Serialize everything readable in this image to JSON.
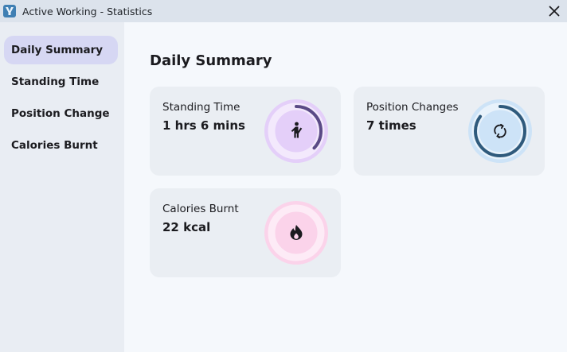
{
  "window": {
    "title": "Active Working - Statistics",
    "app_icon": "app-logo-icon",
    "close_icon": "close-icon"
  },
  "sidebar": {
    "items": [
      {
        "label": "Daily Summary",
        "active": true
      },
      {
        "label": "Standing Time",
        "active": false
      },
      {
        "label": "Position Change",
        "active": false
      },
      {
        "label": "Calories Burnt",
        "active": false
      }
    ],
    "active_bg": "#d6d7f3"
  },
  "main": {
    "title": "Daily Summary",
    "cards": [
      {
        "label": "Standing Time",
        "value": "1 hrs 6 mins",
        "icon": "standing-person-icon",
        "progress": 0.37,
        "ring_color": "#5a4a86",
        "ring_bg": "#e4cff9"
      },
      {
        "label": "Position Changes",
        "value": "7 times",
        "icon": "refresh-arrows-icon",
        "progress": 0.85,
        "ring_color": "#2f5a7c",
        "ring_bg": "#cde3f7"
      },
      {
        "label": "Calories Burnt",
        "value": "22 kcal",
        "icon": "flame-icon",
        "progress": 0,
        "ring_color": "#b0447c",
        "ring_bg": "#fbd3ea"
      }
    ]
  }
}
